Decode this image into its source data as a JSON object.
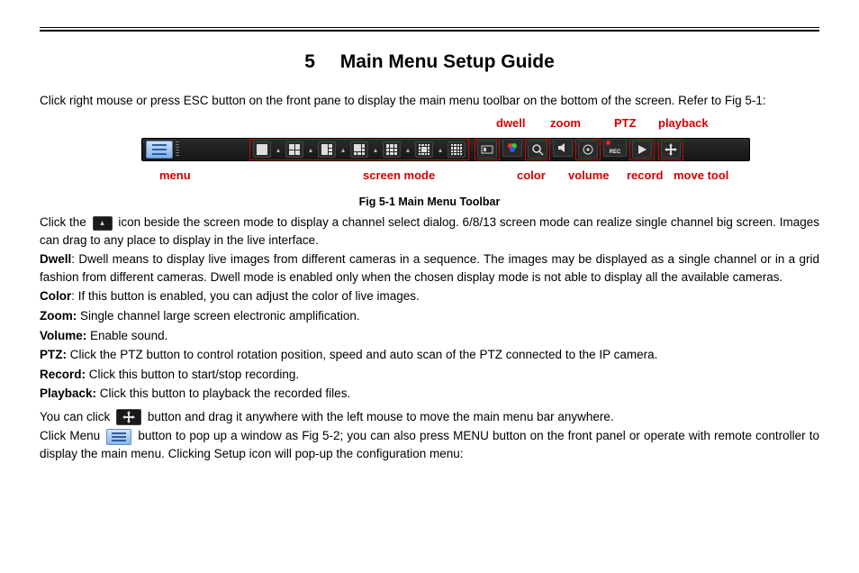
{
  "heading": {
    "number": "5",
    "title": "Main Menu Setup Guide"
  },
  "intro": "Click right mouse or press ESC button on the front pane to display the main menu toolbar on the bottom of the screen. Refer to Fig 5-1:",
  "figure": {
    "caption": "Fig 5-1 Main Menu Toolbar",
    "callouts_top": {
      "dwell": "dwell",
      "zoom": "zoom",
      "ptz": "PTZ",
      "playback": "playback"
    },
    "callouts_bottom": {
      "menu": "menu",
      "screenmode": "screen mode",
      "color": "color",
      "volume": "volume",
      "record": "record",
      "movetool": "move tool"
    },
    "toolbar_items": {
      "menu": "Menu",
      "screen_modes": [
        "1",
        "4",
        "6",
        "8",
        "9",
        "13",
        "16"
      ],
      "dwell": "Dwell",
      "color": "Color",
      "zoom": "Zoom",
      "volume": "Volume",
      "ptz": "PTZ",
      "record": "REC",
      "playback": "Playback",
      "move": "Move"
    }
  },
  "para_click_icon_1": "Click the ",
  "para_click_icon_2": " icon beside the screen mode to display a channel select dialog. 6/8/13 screen mode can realize single channel big screen. Images can drag to any place to display in the live interface.",
  "dwell": {
    "label": "Dwell",
    "text": ": Dwell means to display live images from different cameras in a sequence. The images may be displayed as a single channel or in a grid fashion from different cameras. Dwell mode is enabled only when the chosen display mode is not able to display all the available cameras."
  },
  "color": {
    "label": "Color",
    "text": ": If this button is enabled, you can adjust the color of live images."
  },
  "zoom": {
    "label": "Zoom:",
    "text": " Single channel large screen electronic amplification."
  },
  "volume": {
    "label": "Volume:",
    "text": " Enable sound."
  },
  "ptz": {
    "label": "PTZ:",
    "text": " Click the PTZ button to control rotation position, speed and auto scan of the PTZ connected to the IP camera."
  },
  "record": {
    "label": "Record:",
    "text": " Click this button to start/stop recording."
  },
  "playback": {
    "label": "Playback:",
    "text": " Click this button to playback the recorded files."
  },
  "move1": "You can click ",
  "move2": " button and drag it anywhere with the left mouse to move the main menu bar anywhere.",
  "menu1": "Click Menu ",
  "menu2": " button to pop up a window as Fig 5-2; you can also press MENU button on the front panel or operate with remote controller to display the main menu. Clicking Setup icon will pop-up the configuration menu:"
}
